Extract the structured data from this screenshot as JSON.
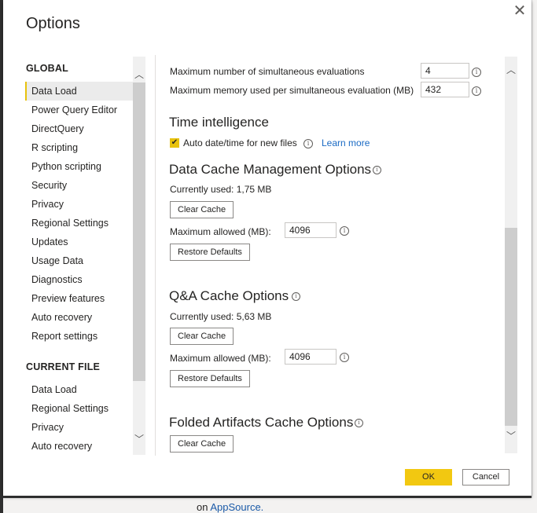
{
  "dialog": {
    "title": "Options",
    "close_icon": "close-icon"
  },
  "nav": {
    "global_header": "GLOBAL",
    "global_items": [
      {
        "label": "Data Load",
        "selected": true
      },
      {
        "label": "Power Query Editor"
      },
      {
        "label": "DirectQuery"
      },
      {
        "label": "R scripting"
      },
      {
        "label": "Python scripting"
      },
      {
        "label": "Security"
      },
      {
        "label": "Privacy"
      },
      {
        "label": "Regional Settings"
      },
      {
        "label": "Updates"
      },
      {
        "label": "Usage Data"
      },
      {
        "label": "Diagnostics"
      },
      {
        "label": "Preview features"
      },
      {
        "label": "Auto recovery"
      },
      {
        "label": "Report settings"
      }
    ],
    "current_header": "CURRENT FILE",
    "current_items": [
      {
        "label": "Data Load"
      },
      {
        "label": "Regional Settings"
      },
      {
        "label": "Privacy"
      },
      {
        "label": "Auto recovery"
      }
    ]
  },
  "content": {
    "max_evaluations_label": "Maximum number of simultaneous evaluations",
    "max_evaluations_value": "4",
    "max_memory_label": "Maximum memory used per simultaneous evaluation (MB)",
    "max_memory_value": "432",
    "time_intelligence": {
      "heading": "Time intelligence",
      "auto_datetime_label": "Auto date/time for new files",
      "auto_datetime_checked": true,
      "learn_more": "Learn more"
    },
    "data_cache": {
      "heading": "Data Cache Management Options",
      "currently_used": "Currently used: 1,75 MB",
      "clear_cache": "Clear Cache",
      "max_allowed_label": "Maximum allowed (MB):",
      "max_allowed_value": "4096",
      "restore_defaults": "Restore Defaults"
    },
    "qa_cache": {
      "heading": "Q&A Cache Options",
      "currently_used": "Currently used: 5,63 MB",
      "clear_cache": "Clear Cache",
      "max_allowed_label": "Maximum allowed (MB):",
      "max_allowed_value": "4096",
      "restore_defaults": "Restore Defaults"
    },
    "folded_cache": {
      "heading": "Folded Artifacts Cache Options",
      "clear_cache": "Clear Cache"
    }
  },
  "footer": {
    "ok": "OK",
    "cancel": "Cancel"
  },
  "background": {
    "partial_text_prefix": "on ",
    "partial_link": "AppSource."
  },
  "colors": {
    "accent": "#f2c811",
    "link": "#1a6ac4"
  }
}
